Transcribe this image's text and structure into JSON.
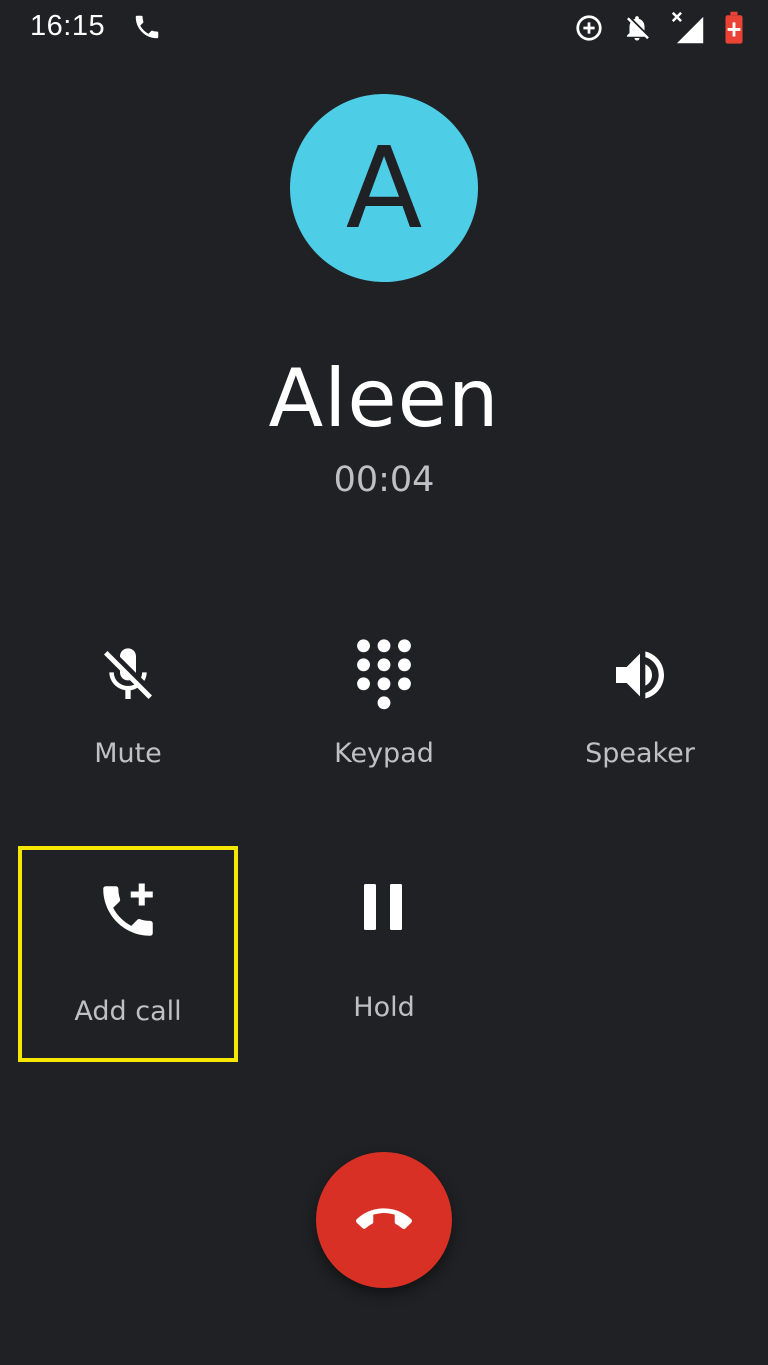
{
  "status_bar": {
    "time": "16:15",
    "icons": [
      "phone-call-icon",
      "data-saver-icon",
      "notifications-off-icon",
      "signal-no-data-icon",
      "battery-alert-icon"
    ],
    "battery_color": "#ea4335"
  },
  "contact": {
    "avatar_letter": "A",
    "avatar_color": "#4ecde6",
    "name": "Aleen",
    "duration": "00:04"
  },
  "controls": {
    "mute": {
      "label": "Mute",
      "icon": "mic-off-icon"
    },
    "keypad": {
      "label": "Keypad",
      "icon": "dialpad-icon"
    },
    "speaker": {
      "label": "Speaker",
      "icon": "volume-up-icon"
    },
    "add_call": {
      "label": "Add call",
      "icon": "add-call-icon",
      "highlight_color": "#f5e700"
    },
    "hold": {
      "label": "Hold",
      "icon": "pause-icon"
    }
  },
  "end_call": {
    "icon": "call-end-icon",
    "color": "#d93025"
  }
}
